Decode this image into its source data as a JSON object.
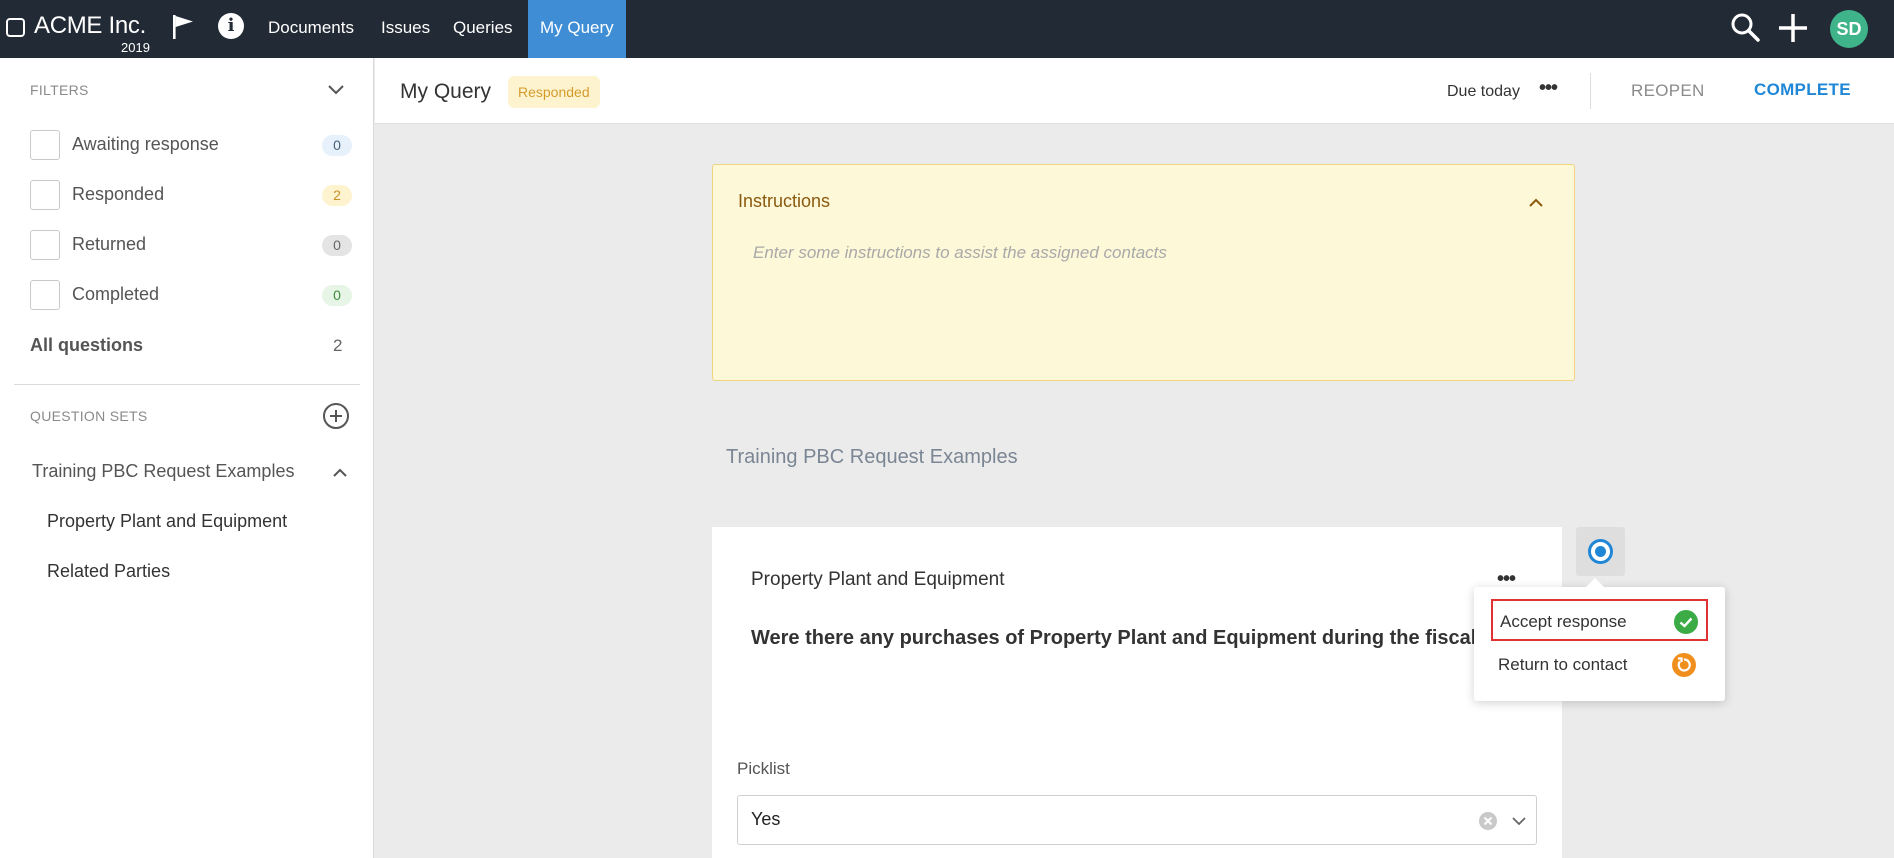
{
  "nav": {
    "brand": "ACME Inc.",
    "year": "2019",
    "links": [
      "Documents",
      "Issues",
      "Queries",
      "My Query"
    ],
    "active_link": "My Query",
    "avatar_initials": "SD",
    "colors": {
      "nav_bg": "#222a35",
      "active_tab": "#3f8ed5",
      "avatar": "#3fb38a"
    },
    "icons": [
      "flag-icon",
      "info-icon",
      "search-icon",
      "plus-icon"
    ]
  },
  "sidebar": {
    "filters_title": "FILTERS",
    "filters": [
      {
        "label": "Awaiting response",
        "count": "0",
        "color": "#e6f1fb"
      },
      {
        "label": "Responded",
        "count": "2",
        "color": "#fdf4cf"
      },
      {
        "label": "Returned",
        "count": "0",
        "color": "#e4e4e4"
      },
      {
        "label": "Completed",
        "count": "0",
        "color": "#e6f5e6"
      }
    ],
    "all_questions_label": "All questions",
    "all_questions_count": "2",
    "question_sets_title": "QUESTION SETS",
    "question_set": {
      "name": "Training PBC Request Examples",
      "items": [
        "Property Plant and Equipment",
        "Related Parties"
      ]
    }
  },
  "header": {
    "title": "My Query",
    "status": "Responded",
    "due": "Due today",
    "reopen_label": "REOPEN",
    "complete_label": "COMPLETE",
    "colors": {
      "complete": "#1f87d6"
    }
  },
  "instructions": {
    "title": "Instructions",
    "placeholder": "Enter some instructions to assist the assigned contacts",
    "colors": {
      "bg": "#fdf8d8",
      "border": "#f1d47e"
    }
  },
  "main": {
    "set_heading": "Training PBC Request Examples",
    "question": {
      "title": "Property Plant and Equipment",
      "text": "Were there any purchases of Property Plant and Equipment during the fiscal year?",
      "picklist_label": "Picklist",
      "picklist_value": "Yes"
    }
  },
  "popover": {
    "items": [
      {
        "label": "Accept response",
        "icon": "check-circle-icon",
        "color": "#3aab45"
      },
      {
        "label": "Return to contact",
        "icon": "return-circle-icon",
        "color": "#f18f1e"
      }
    ],
    "highlight_color": "#e03232"
  }
}
